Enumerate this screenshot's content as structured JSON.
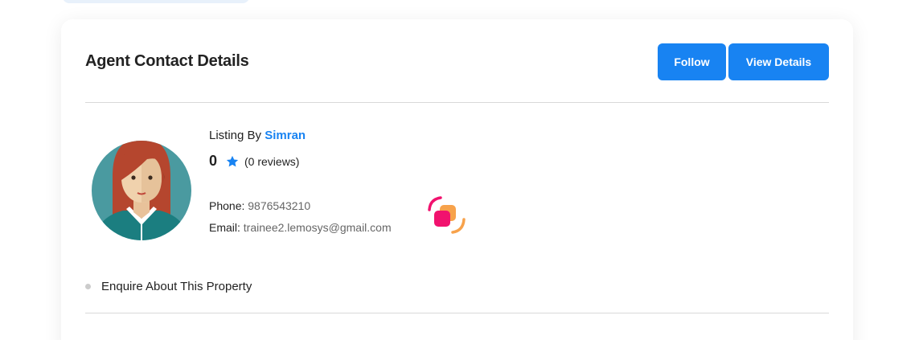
{
  "card": {
    "title": "Agent Contact Details",
    "follow_label": "Follow",
    "view_details_label": "View Details"
  },
  "agent": {
    "listing_prefix": "Listing By",
    "name": "Simran",
    "rating": "0",
    "reviews": "(0 reviews)",
    "phone_label": "Phone:",
    "phone": "9876543210",
    "email_label": "Email:",
    "email": "trainee2.lemosys@gmail.com"
  },
  "enquire": {
    "label": "Enquire About This Property"
  },
  "colors": {
    "accent": "#1883f2",
    "avatar_bg": "#4a9aa0",
    "hair": "#b5462e",
    "app_icon_pink": "#f1126e",
    "app_icon_orange": "#f7a24b"
  },
  "icons": {
    "rating": "star-icon",
    "app": "app-logo-icon",
    "bullet": "bullet-dot-icon"
  }
}
